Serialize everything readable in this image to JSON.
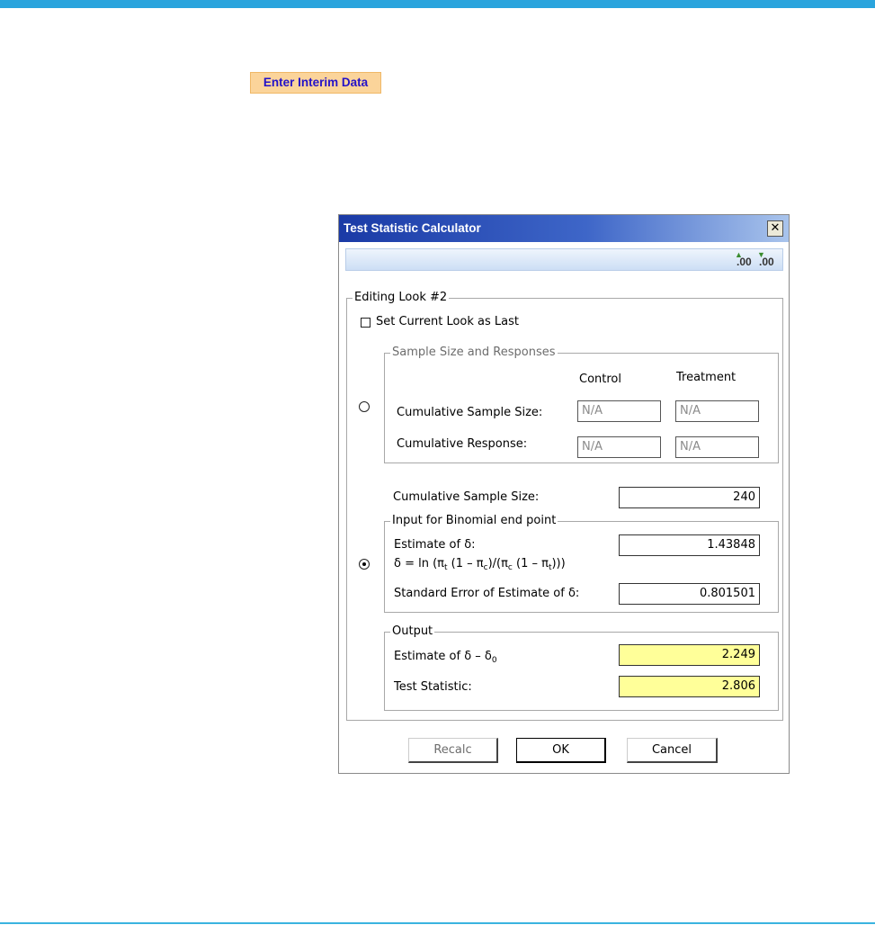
{
  "page": {
    "interim_button": "Enter Interim Data"
  },
  "dialog": {
    "title": "Test Statistic Calculator",
    "close_glyph": "✕",
    "toolbar": {
      "increase_decimal": ".00",
      "decrease_decimal": ".00"
    },
    "editing_look": "Editing Look #2",
    "set_current_last": "Set Current Look as Last",
    "sample_size_group": {
      "legend": "Sample Size and Responses",
      "col_control": "Control",
      "col_treatment": "Treatment",
      "cum_sample_label": "Cumulative Sample Size:",
      "cum_response_label": "Cumulative Response:",
      "control_sample_value": "N/A",
      "treatment_sample_value": "N/A",
      "control_response_value": "N/A",
      "treatment_response_value": "N/A"
    },
    "cum_sample_label": "Cumulative Sample Size:",
    "cum_sample_value": "240",
    "binomial_group": {
      "legend": "Input for Binomial end point",
      "estimate_label": "Estimate of δ:",
      "estimate_value": "1.43848",
      "formula_text": "δ = ln (π",
      "formula_sub_t": "t",
      "formula_mid1": " (1 – π",
      "formula_sub_c": "c",
      "formula_mid2": ")/(π",
      "formula_sub_c2": "c",
      "formula_mid3": " (1 – π",
      "formula_sub_t2": "t",
      "formula_end": ")))",
      "se_label": "Standard Error of Estimate of δ:",
      "se_value": "0.801501"
    },
    "output_group": {
      "legend": "Output",
      "estimate_diff_label": "Estimate of δ – δ",
      "estimate_diff_sub": "0",
      "estimate_diff_value": "2.249",
      "test_stat_label": "Test Statistic:",
      "test_stat_value": "2.806"
    },
    "buttons": {
      "recalc": "Recalc",
      "ok": "OK",
      "cancel": "Cancel"
    }
  }
}
